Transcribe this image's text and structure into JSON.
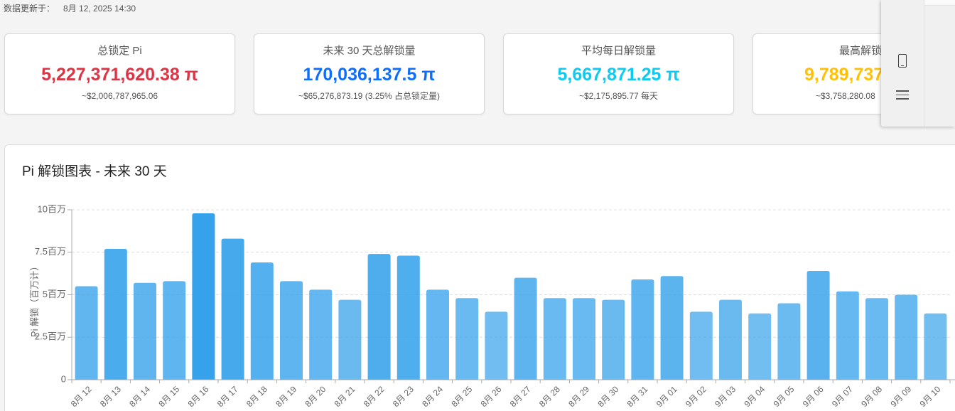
{
  "header": {
    "updated_label": "数据更新于：",
    "updated_value": "8月 12, 2025 14:30"
  },
  "stats": [
    {
      "label": "总锁定 Pi",
      "value": "5,227,371,620.38 π",
      "sub": "~$2,006,787,965.06",
      "color": "#dc3545"
    },
    {
      "label": "未来 30 天总解锁量",
      "value": "170,036,137.5 π",
      "sub": "~$65,276,873.19 (3.25% 占总锁定量)",
      "color": "#0d6efd"
    },
    {
      "label": "平均每日解锁量",
      "value": "5,667,871.25 π",
      "sub": "~$2,175,895.77 每天",
      "color": "#0dcaf0"
    },
    {
      "label": "最高解锁",
      "value": "9,789,737",
      "sub": "~$3,758,280.08",
      "color": "#ffc107"
    }
  ],
  "chart_data": {
    "type": "bar",
    "title": "Pi 解锁图表 - 未来 30 天",
    "xlabel": "",
    "ylabel": "Pi 解锁（百万计）",
    "categories": [
      "8月 12",
      "8月 13",
      "8月 14",
      "8月 15",
      "8月 16",
      "8月 17",
      "8月 18",
      "8月 19",
      "8月 20",
      "8月 21",
      "8月 22",
      "8月 23",
      "8月 24",
      "8月 25",
      "8月 26",
      "8月 27",
      "8月 28",
      "8月 29",
      "8月 30",
      "8月 31",
      "9月 01",
      "9月 02",
      "9月 03",
      "9月 04",
      "9月 05",
      "9月 06",
      "9月 07",
      "9月 08",
      "9月 09",
      "9月 10"
    ],
    "values": [
      5500000,
      7700000,
      5700000,
      5800000,
      9789737,
      8300000,
      6900000,
      5800000,
      5300000,
      4700000,
      7400000,
      7300000,
      5300000,
      4800000,
      4000000,
      6000000,
      4800000,
      4800000,
      4700000,
      5900000,
      6100000,
      4000000,
      4700000,
      3900000,
      4500000,
      6400000,
      5200000,
      4800000,
      5000000,
      3900000
    ],
    "ylim": [
      0,
      10000000
    ],
    "y_ticks": [
      {
        "value": 0,
        "label": "0"
      },
      {
        "value": 2500000,
        "label": "2.5百万"
      },
      {
        "value": 5000000,
        "label": "5百万"
      },
      {
        "value": 7500000,
        "label": "7.5百万"
      },
      {
        "value": 10000000,
        "label": "10百万"
      }
    ],
    "grid": true,
    "legend": "none",
    "bar_color": "#36a2eb"
  },
  "toolbar": {
    "icons": [
      "tablet-icon",
      "hamburger-menu-icon"
    ]
  }
}
